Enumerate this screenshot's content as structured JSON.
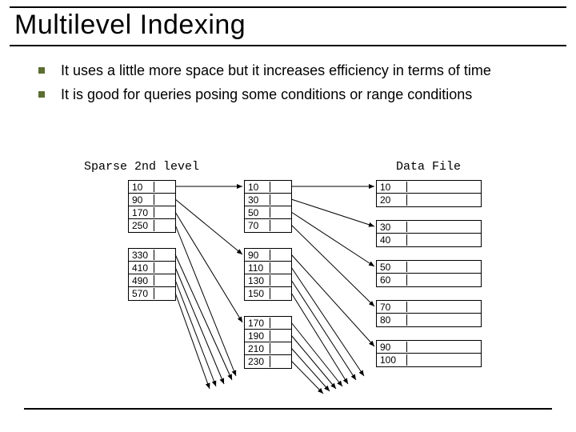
{
  "title": "Multilevel Indexing",
  "bullets": [
    "It uses a little more space but it increases efficiency in terms of time",
    "It is good for queries posing some conditions or range conditions"
  ],
  "labels": {
    "sparse": "Sparse 2nd level",
    "data": "Data File"
  },
  "sparse_blocks": [
    [
      "10",
      "90",
      "170",
      "250"
    ],
    [
      "330",
      "410",
      "490",
      "570"
    ]
  ],
  "dense_blocks": [
    [
      "10",
      "30",
      "50",
      "70"
    ],
    [
      "90",
      "110",
      "130",
      "150"
    ],
    [
      "170",
      "190",
      "210",
      "230"
    ]
  ],
  "data_blocks": [
    [
      "10",
      "20"
    ],
    [
      "30",
      "40"
    ],
    [
      "50",
      "60"
    ],
    [
      "70",
      "80"
    ],
    [
      "90",
      "100"
    ]
  ]
}
